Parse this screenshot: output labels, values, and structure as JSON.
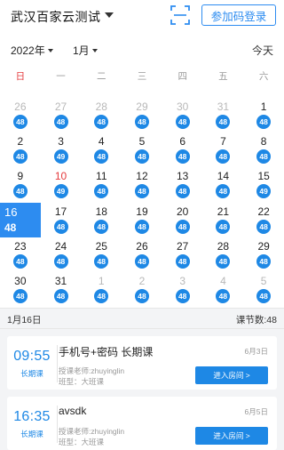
{
  "header": {
    "title": "武汉百家云测试",
    "join_label": "参加码登录"
  },
  "selectors": {
    "year": "2022年",
    "month": "1月",
    "today_label": "今天"
  },
  "weekdays": [
    "日",
    "一",
    "二",
    "三",
    "四",
    "五",
    "六"
  ],
  "calendar": [
    {
      "day": "26",
      "badge": "48",
      "other": true
    },
    {
      "day": "27",
      "badge": "48",
      "other": true
    },
    {
      "day": "28",
      "badge": "48",
      "other": true
    },
    {
      "day": "29",
      "badge": "48",
      "other": true
    },
    {
      "day": "30",
      "badge": "48",
      "other": true
    },
    {
      "day": "31",
      "badge": "48",
      "other": true
    },
    {
      "day": "1",
      "badge": "48"
    },
    {
      "day": "2",
      "badge": "48"
    },
    {
      "day": "3",
      "badge": "49"
    },
    {
      "day": "4",
      "badge": "48"
    },
    {
      "day": "5",
      "badge": "48"
    },
    {
      "day": "6",
      "badge": "48"
    },
    {
      "day": "7",
      "badge": "48"
    },
    {
      "day": "8",
      "badge": "48"
    },
    {
      "day": "9",
      "badge": "48"
    },
    {
      "day": "10",
      "badge": "49",
      "red": true
    },
    {
      "day": "11",
      "badge": "48"
    },
    {
      "day": "12",
      "badge": "48"
    },
    {
      "day": "13",
      "badge": "48"
    },
    {
      "day": "14",
      "badge": "48"
    },
    {
      "day": "15",
      "badge": "49"
    },
    {
      "day": "16",
      "badge": "48",
      "selected": true
    },
    {
      "day": "17",
      "badge": "48"
    },
    {
      "day": "18",
      "badge": "48"
    },
    {
      "day": "19",
      "badge": "48"
    },
    {
      "day": "20",
      "badge": "48"
    },
    {
      "day": "21",
      "badge": "48"
    },
    {
      "day": "22",
      "badge": "48"
    },
    {
      "day": "23",
      "badge": "48"
    },
    {
      "day": "24",
      "badge": "48"
    },
    {
      "day": "25",
      "badge": "48"
    },
    {
      "day": "26",
      "badge": "48"
    },
    {
      "day": "27",
      "badge": "48"
    },
    {
      "day": "28",
      "badge": "48"
    },
    {
      "day": "29",
      "badge": "48"
    },
    {
      "day": "30",
      "badge": "48"
    },
    {
      "day": "31",
      "badge": "48"
    },
    {
      "day": "1",
      "badge": "48",
      "other": true
    },
    {
      "day": "2",
      "badge": "48",
      "other": true
    },
    {
      "day": "3",
      "badge": "48",
      "other": true
    },
    {
      "day": "4",
      "badge": "48",
      "other": true
    },
    {
      "day": "5",
      "badge": "48",
      "other": true
    }
  ],
  "summary": {
    "date": "1月16日",
    "count": "课节数:48"
  },
  "lessons": [
    {
      "time": "09:55",
      "kind": "长期课",
      "name": "手机号+密码 长期课",
      "date": "6月3日",
      "teacher": "授课老师:zhuyinglin",
      "type": "班型：大班课",
      "enter_label": "进入房间 >"
    },
    {
      "time": "16:35",
      "kind": "长期课",
      "name": "avsdk",
      "date": "6月5日",
      "teacher": "授课老师:zhuyinglin",
      "type": "班型：大班课",
      "enter_label": "进入房间 >"
    }
  ],
  "colors": {
    "accent": "#1e88e5",
    "selected": "#2d8cf0",
    "sunday": "#e4393c",
    "muted": "#b8b8b8"
  },
  "icons": {
    "scan": "scan-icon",
    "caret": "caret-down-icon"
  }
}
